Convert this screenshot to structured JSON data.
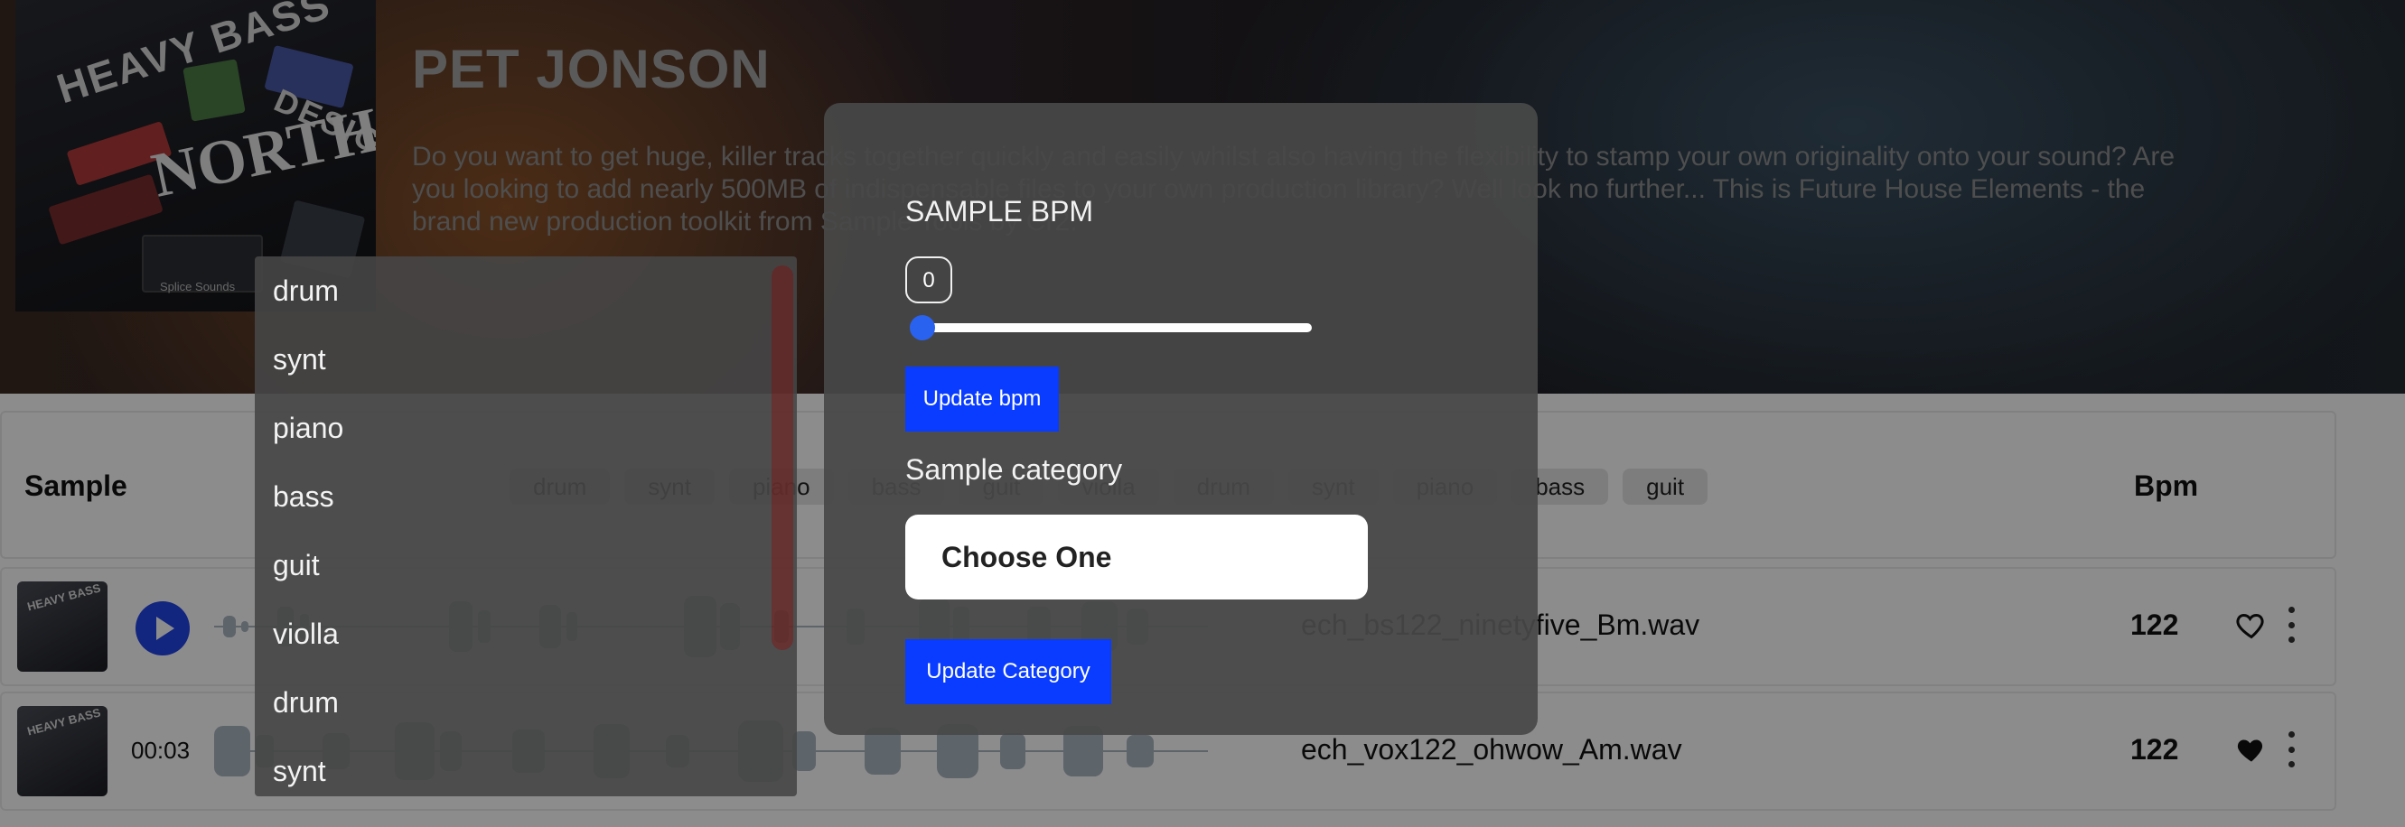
{
  "cover": {
    "words": [
      "HEAVY BASS",
      "DESIGN",
      "NORTH"
    ],
    "badge": "Splice Sounds"
  },
  "title": "PET JONSON",
  "description": "Do you want to get huge, killer tracks together quickly and easily whilst also having the flexibility to stamp your own originality onto your sound? Are you looking to add nearly 500MB of indispensable files to your own production library? Well look no further... This is Future House Elements - the brand new production toolkit from Sample Tools by Cr2.",
  "table": {
    "sample_header": "Sample",
    "bpm_header": "Bpm",
    "chips": [
      "drum",
      "synt",
      "piano",
      "bass",
      "guit",
      "violla",
      "drum",
      "synt",
      "piano",
      "bass",
      "guit"
    ],
    "rows": [
      {
        "filename": "ech_bs122_ninetyfive_Bm.wav",
        "bpm": "122",
        "time": "",
        "liked": false
      },
      {
        "filename": "ech_vox122_ohwow_Am.wav",
        "bpm": "122",
        "time": "00:03",
        "liked": true
      }
    ]
  },
  "dropdown": {
    "items": [
      "drum",
      "synt",
      "piano",
      "bass",
      "guit",
      "violla",
      "drum",
      "synt"
    ]
  },
  "modal": {
    "bpm_label": "SAMPLE BPM",
    "bpm_value": "0",
    "slider_level": 0,
    "update_bpm": "Update bpm",
    "category_label": "Sample category",
    "select_value": "Choose One",
    "update_category": "Update Category"
  },
  "colors": {
    "primary": "#0a3cff",
    "play": "#2244e8",
    "slider_thumb": "#2a62f0"
  },
  "icons": [
    "play-icon",
    "heart-outline-icon",
    "heart-filled-icon",
    "more-vertical-icon"
  ]
}
